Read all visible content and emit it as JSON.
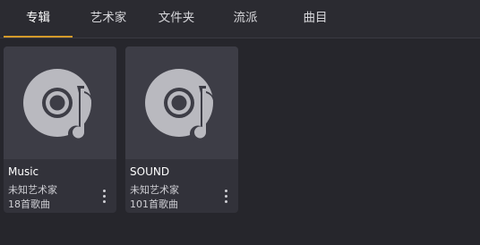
{
  "tabs": [
    {
      "label": "专辑",
      "active": true
    },
    {
      "label": "艺术家"
    },
    {
      "label": "文件夹"
    },
    {
      "label": "流派"
    },
    {
      "label": "曲目"
    }
  ],
  "accent_color": "#d49b2a",
  "albums": [
    {
      "title": "Music",
      "artist": "未知艺术家",
      "count": "18首歌曲",
      "icon": "album-art-icon",
      "menu_icon": "more-vert-icon"
    },
    {
      "title": "SOUND",
      "artist": "未知艺术家",
      "count": "101首歌曲",
      "icon": "album-art-icon",
      "menu_icon": "more-vert-icon"
    }
  ]
}
